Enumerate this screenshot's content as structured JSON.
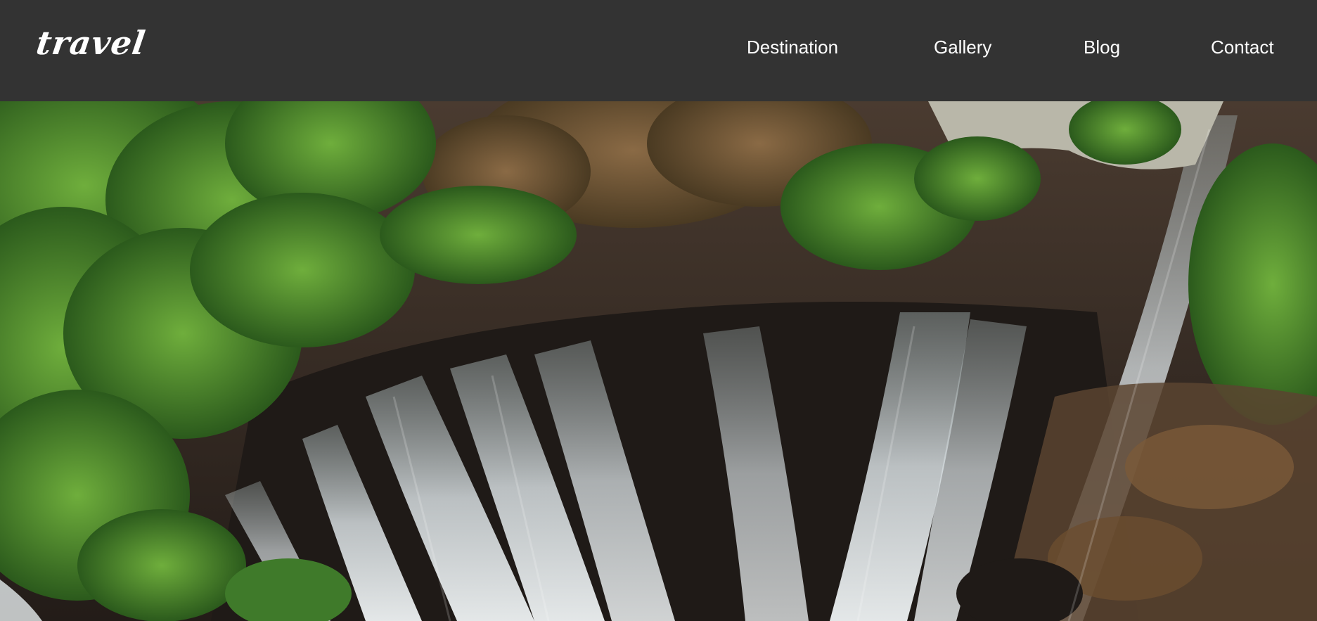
{
  "header": {
    "logo_text": "travel"
  },
  "nav": {
    "items": [
      {
        "label": "Destination"
      },
      {
        "label": "Gallery"
      },
      {
        "label": "Blog"
      },
      {
        "label": "Contact"
      }
    ]
  },
  "colors": {
    "header_background": "#333333",
    "nav_text": "#ffffff",
    "foliage": "#3f7a2a",
    "waterfall": "#dfe6e8",
    "rock": "#3a2e26"
  }
}
